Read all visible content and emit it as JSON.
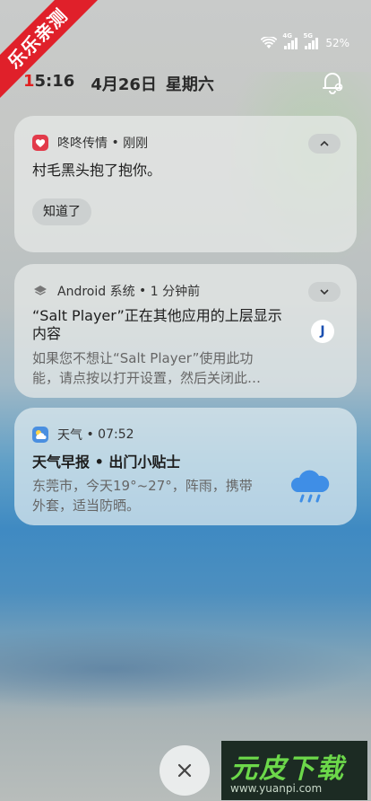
{
  "watermark_top": "乐乐亲测",
  "status": {
    "battery": "52%",
    "sig1": "4G",
    "sig2": "5G"
  },
  "header": {
    "time_red": "1",
    "time_rest": "5:16",
    "date": "4月26日",
    "weekday": "星期六"
  },
  "notifications": [
    {
      "app": "咚咚传情",
      "time": "刚刚",
      "message": "村毛黑头抱了抱你。",
      "action": "知道了",
      "icon_color": "#e23a4a"
    },
    {
      "app": "Android 系统",
      "time": "1 分钟前",
      "title_line1": "“Salt Player”正在其他应用的上层显示",
      "title_line2": "内容",
      "body_line1": "如果您不想让“Salt Player”使用此功",
      "body_line2": "能，请点按以打开设置，然后关闭此…",
      "badge": "J"
    },
    {
      "app": "天气",
      "time": "07:52",
      "title": "天气早报 • 出门小贴士",
      "body_line1": "东莞市，今天19°~27°，阵雨，携带",
      "body_line2": "外套，适当防晒。"
    }
  ],
  "bottom_watermark": {
    "brand": "元皮下载",
    "url": "www.yuanpi.com"
  },
  "separator": " • "
}
